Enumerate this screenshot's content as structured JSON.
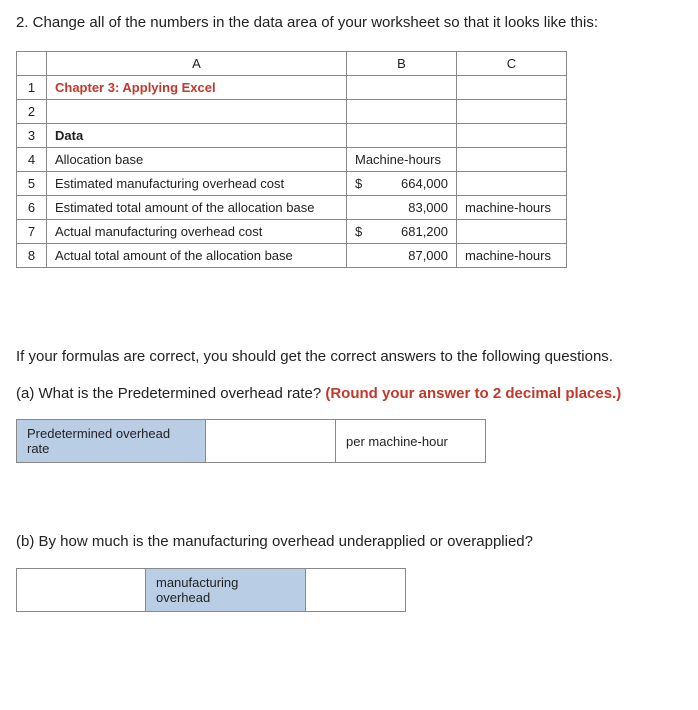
{
  "question_intro": "2. Change all of the numbers in the data area of your worksheet so that it looks like this:",
  "spreadsheet": {
    "col_headers": {
      "a": "A",
      "b": "B",
      "c": "C"
    },
    "rows": {
      "r1": {
        "num": "1",
        "a": "Chapter 3: Applying Excel",
        "b": "",
        "c": ""
      },
      "r2": {
        "num": "2",
        "a": "",
        "b": "",
        "c": ""
      },
      "r3": {
        "num": "3",
        "a": "Data",
        "b": "",
        "c": ""
      },
      "r4": {
        "num": "4",
        "a": "Allocation base",
        "b": "Machine-hours",
        "c": ""
      },
      "r5": {
        "num": "5",
        "a": "Estimated manufacturing overhead cost",
        "b_sym": "$",
        "b_val": "664,000",
        "c": ""
      },
      "r6": {
        "num": "6",
        "a": "Estimated total amount of the allocation base",
        "b": "83,000",
        "c": "machine-hours"
      },
      "r7": {
        "num": "7",
        "a": "Actual manufacturing overhead cost",
        "b_sym": "$",
        "b_val": "681,200",
        "c": ""
      },
      "r8": {
        "num": "8",
        "a": "Actual total amount of the allocation base",
        "b": "87,000",
        "c": "machine-hours"
      }
    }
  },
  "followup": "If your formulas are correct, you should get the correct answers to the following questions.",
  "part_a": {
    "prompt": "(a) What is the Predetermined overhead rate? ",
    "instruct": "(Round your answer to 2 decimal places.)",
    "label": "Predetermined overhead rate",
    "unit": "per machine-hour"
  },
  "part_b": {
    "prompt": "(b) By how much is the manufacturing overhead underapplied or overapplied?",
    "label": "manufacturing overhead"
  }
}
